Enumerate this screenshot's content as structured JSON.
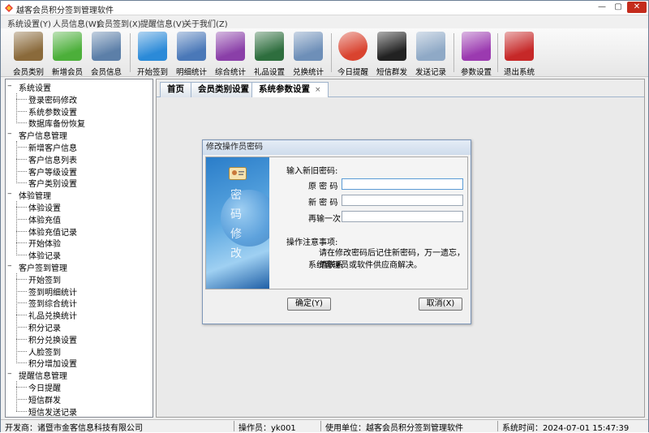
{
  "window": {
    "title": "越客会员积分签到管理软件",
    "min_glyph": "—",
    "max_glyph": "▢",
    "close_glyph": "✕"
  },
  "menu": [
    "系统设置(Y)",
    "人员信息(W)",
    "会员签到(X)",
    "提醒信息(V)",
    "关于我们(Z)"
  ],
  "toolbar": [
    {
      "label": "会员类别",
      "icon": "member-category-icon",
      "color": "#8a6a3b"
    },
    {
      "label": "新增会员",
      "icon": "add-member-icon",
      "color": "#4caf3a"
    },
    {
      "label": "会员信息",
      "icon": "member-info-icon",
      "color": "#5c7fa8"
    },
    {
      "label": "开始签到",
      "icon": "pencils-icon",
      "color": "#2b8ad8"
    },
    {
      "label": "明细统计",
      "icon": "clock-folder-icon",
      "color": "#4a78b8"
    },
    {
      "label": "综合统计",
      "icon": "wave-chart-icon",
      "color": "#8a3fa8"
    },
    {
      "label": "礼品设置",
      "icon": "evernote-icon",
      "color": "#2e6e3e"
    },
    {
      "label": "兑换统计",
      "icon": "folder-icon",
      "color": "#6e8fb8"
    },
    {
      "label": "今日提醒",
      "icon": "chrome-icon",
      "color": "#d9432f"
    },
    {
      "label": "短信群发",
      "icon": "terminal-icon",
      "color": "#222222"
    },
    {
      "label": "发送记录",
      "icon": "document-folder-icon",
      "color": "#8fa9c6"
    },
    {
      "label": "参数设置",
      "icon": "gear-icon",
      "color": "#9b3ab0"
    },
    {
      "label": "退出系统",
      "icon": "exit-icon",
      "color": "#c62828"
    }
  ],
  "tree": [
    {
      "label": "系统设置",
      "items": [
        "登录密码修改",
        "系统参数设置",
        "数据库备份恢复"
      ]
    },
    {
      "label": "客户信息管理",
      "items": [
        "新增客户信息",
        "客户信息列表",
        "客户等级设置",
        "客户类别设置"
      ]
    },
    {
      "label": "体验管理",
      "items": [
        "体验设置",
        "体验充值",
        "体验充值记录",
        "开始体验",
        "体验记录"
      ]
    },
    {
      "label": "客户签到管理",
      "items": [
        "开始签到",
        "签到明细统计",
        "签到综合统计",
        "礼品兑换统计",
        "积分记录",
        "积分兑换设置",
        "人脸签到",
        "积分增加设置"
      ]
    },
    {
      "label": "提醒信息管理",
      "items": [
        "今日提醒",
        "短信群发",
        "短信发送记录"
      ]
    }
  ],
  "tree_expander": "−",
  "tabs": [
    {
      "label": "首页"
    },
    {
      "label": "会员类别设置"
    },
    {
      "label": "系统参数设置",
      "close": "×"
    }
  ],
  "dialog": {
    "title": "修改操作员密码",
    "heading": "输入新旧密码:",
    "old_label": "原 密 码",
    "new_label": "新 密 码",
    "confirm_label": "再输一次",
    "old_value": "",
    "new_value": "",
    "confirm_value": "",
    "note_title": "操作注意事项:",
    "note_line1": "请在修改密码后记住新密码，万一遗忘，请联系",
    "note_line2": "系统管理员或软件供应商解决。",
    "image_text": [
      "密",
      "码",
      "修",
      "改"
    ],
    "ok_label": "确定(Y)",
    "cancel_label": "取消(X)"
  },
  "status": {
    "developer": "开发商：诸暨市金客信息科技有限公司",
    "operator": "操作员：yk001",
    "unit": "使用单位：越客会员积分签到管理软件",
    "time": "系统时间：2024-07-01 15:47:39"
  }
}
